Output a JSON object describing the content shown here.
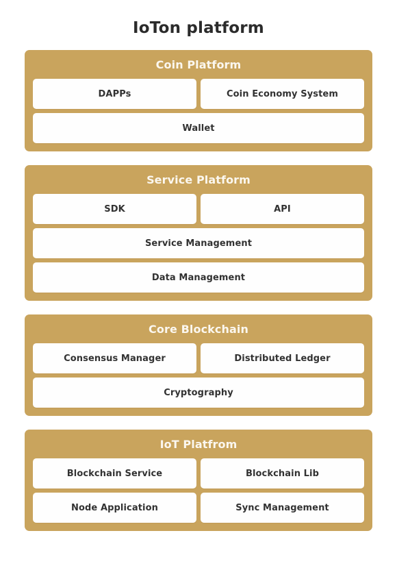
{
  "header": {
    "title": "IoTon platform"
  },
  "colors": {
    "layer_background": "#c9a45d",
    "layer_title_text": "#fbf7ef",
    "cell_background": "#fefefe",
    "cell_text": "#323232",
    "page_background": "#ffffff",
    "page_title_text": "#2b2b2b"
  },
  "chart_data": {
    "type": "table",
    "title": "IoTon platform",
    "layers": [
      {
        "title": "Coin Platform",
        "rows": [
          [
            "DAPPs",
            "Coin Economy System"
          ],
          [
            "Wallet"
          ]
        ]
      },
      {
        "title": "Service Platform",
        "rows": [
          [
            "SDK",
            "API"
          ],
          [
            "Service Management"
          ],
          [
            "Data Management"
          ]
        ]
      },
      {
        "title": "Core Blockchain",
        "rows": [
          [
            "Consensus Manager",
            "Distributed Ledger"
          ],
          [
            "Cryptography"
          ]
        ]
      },
      {
        "title": "IoT Platfrom",
        "rows": [
          [
            "Blockchain Service",
            "Blockchain Lib"
          ],
          [
            "Node Application",
            "Sync Management"
          ]
        ]
      }
    ]
  },
  "layers": [
    {
      "title": "Coin Platform",
      "rows": [
        {
          "cells": [
            "DAPPs",
            "Coin Economy System"
          ]
        },
        {
          "cells": [
            "Wallet"
          ]
        }
      ]
    },
    {
      "title": "Service Platform",
      "rows": [
        {
          "cells": [
            "SDK",
            "API"
          ]
        },
        {
          "cells": [
            "Service Management"
          ]
        },
        {
          "cells": [
            "Data Management"
          ]
        }
      ]
    },
    {
      "title": "Core Blockchain",
      "rows": [
        {
          "cells": [
            "Consensus Manager",
            "Distributed Ledger"
          ]
        },
        {
          "cells": [
            "Cryptography"
          ]
        }
      ]
    },
    {
      "title": "IoT Platfrom",
      "rows": [
        {
          "cells": [
            "Blockchain Service",
            "Blockchain Lib"
          ]
        },
        {
          "cells": [
            "Node Application",
            "Sync Management"
          ]
        }
      ]
    }
  ]
}
